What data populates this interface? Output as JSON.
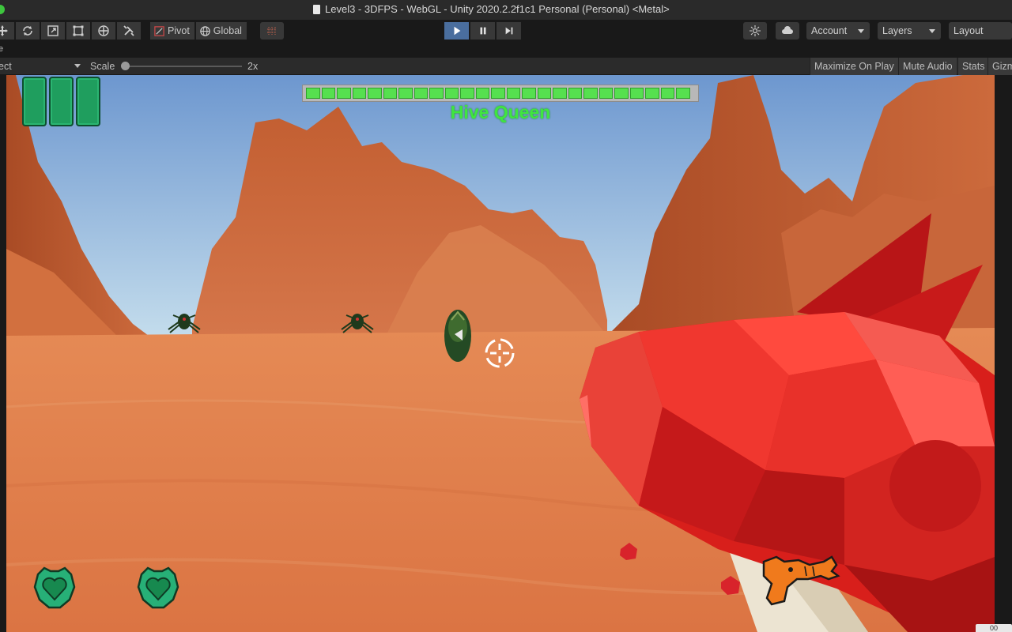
{
  "window": {
    "title": "Level3 - 3DFPS - WebGL - Unity 2020.2.2f1c1 Personal (Personal) <Metal>"
  },
  "toolbar": {
    "tools": [
      "move-tool",
      "rotate-tool",
      "scale-tool",
      "rect-tool",
      "transform-tool",
      "custom-tool"
    ],
    "pivot_label": "Pivot",
    "global_label": "Global",
    "account_label": "Account",
    "layers_label": "Layers",
    "layout_label": "Layout"
  },
  "tab_strip": {
    "label": "e"
  },
  "game_view": {
    "display_label": "ect",
    "scale_label": "Scale",
    "scale_value": "2x",
    "toggles": [
      "Maximize On Play",
      "Mute Audio",
      "Stats",
      "Gizm"
    ]
  },
  "hud": {
    "player_health_blocks": 3,
    "boss_name": "Hive Queen",
    "boss_health_fraction": 1.0,
    "boss_health_segments": 25,
    "lives": 2,
    "weapon": "orange-raygun-icon"
  },
  "colors": {
    "boss_name": "#3fe63f",
    "health_block": "#1f9e5e",
    "play_active": "#4a6e9e",
    "sky": "#8fb9e6",
    "ground": "#e07b47",
    "gun": "#e3231e"
  },
  "corner_badge": "00"
}
